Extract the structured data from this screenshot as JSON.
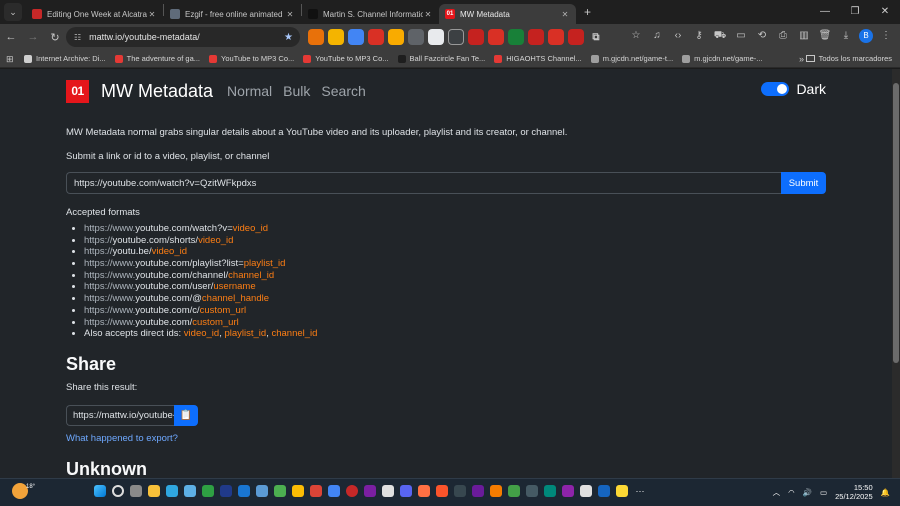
{
  "browser": {
    "tabs": [
      {
        "title": "Editing One Week at Alcatraz |",
        "favicon_color": "#c62828",
        "active": false
      },
      {
        "title": "Ezgif - free online animated GIF",
        "favicon_color": "#5f6b7a",
        "active": false
      },
      {
        "title": "Martin S. Channel Information",
        "favicon_color": "#111111",
        "active": false
      },
      {
        "title": "MW Metadata",
        "favicon_color": "#e5161b",
        "favicon_text": "01",
        "active": true
      }
    ],
    "url": "mattw.io/youtube-metadata/",
    "profile_initial": "B",
    "bookmarks": [
      {
        "label": "Internet Archive: Di...",
        "color": "#cfcfcf"
      },
      {
        "label": "The adventure of ga...",
        "color": "#e53935"
      },
      {
        "label": "YouTube to MP3 Co...",
        "color": "#e53935"
      },
      {
        "label": "YouTube to MP3 Co...",
        "color": "#e53935"
      },
      {
        "label": "Ball Fazcircle Fan Te...",
        "color": "#1e1e1e"
      },
      {
        "label": "HIGAOHTS Channel...",
        "color": "#e53935"
      },
      {
        "label": "m.gjcdn.net/game-t...",
        "color": "#9e9e9e"
      },
      {
        "label": "m.gjcdn.net/game-...",
        "color": "#9e9e9e"
      }
    ],
    "all_bookmarks_label": "Todos los marcadores"
  },
  "site": {
    "logo_text": "01",
    "brand": "MW Metadata",
    "nav": [
      "Normal",
      "Bulk",
      "Search"
    ],
    "theme_toggle_label": "Dark",
    "intro": "MW Metadata normal grabs singular details about a YouTube video and its uploader, playlist and its creator, or channel.",
    "prompt": "Submit a link or id to a video, playlist, or channel",
    "input_value": "https://youtube.com/watch?v=QzitWFkpdxs",
    "submit_label": "Submit",
    "formats_title": "Accepted formats",
    "formats": [
      {
        "pre": "https://www.",
        "host": "youtube.com/watch?v=",
        "ph": "video_id"
      },
      {
        "pre": "https://",
        "host": "youtube.com/shorts/",
        "ph": "video_id"
      },
      {
        "pre": "https://",
        "host": "youtu.be/",
        "ph": "video_id"
      },
      {
        "pre": "https://www.",
        "host": "youtube.com/playlist?list=",
        "ph": "playlist_id"
      },
      {
        "pre": "https://www.",
        "host": "youtube.com/channel/",
        "ph": "channel_id"
      },
      {
        "pre": "https://www.",
        "host": "youtube.com/user/",
        "ph": "username"
      },
      {
        "pre": "https://www.",
        "host": "youtube.com/@",
        "ph": "channel_handle"
      },
      {
        "pre": "https://www.",
        "host": "youtube.com/c/",
        "ph": "custom_url"
      },
      {
        "pre": "https://www.",
        "host": "youtube.com/",
        "ph": "custom_url"
      }
    ],
    "direct_ids": {
      "prefix": "Also accepts direct ids: ",
      "ids": [
        "video_id",
        "playlist_id",
        "channel_id"
      ]
    },
    "share_heading": "Share",
    "share_sub": "Share this result:",
    "share_value": "https://mattw.io/youtube-metadata/",
    "export_link": "What happened to export?",
    "unknown_heading": "Unknown"
  },
  "taskbar": {
    "temperature": "18°",
    "time": "15:50",
    "date": "25/12/2025"
  }
}
